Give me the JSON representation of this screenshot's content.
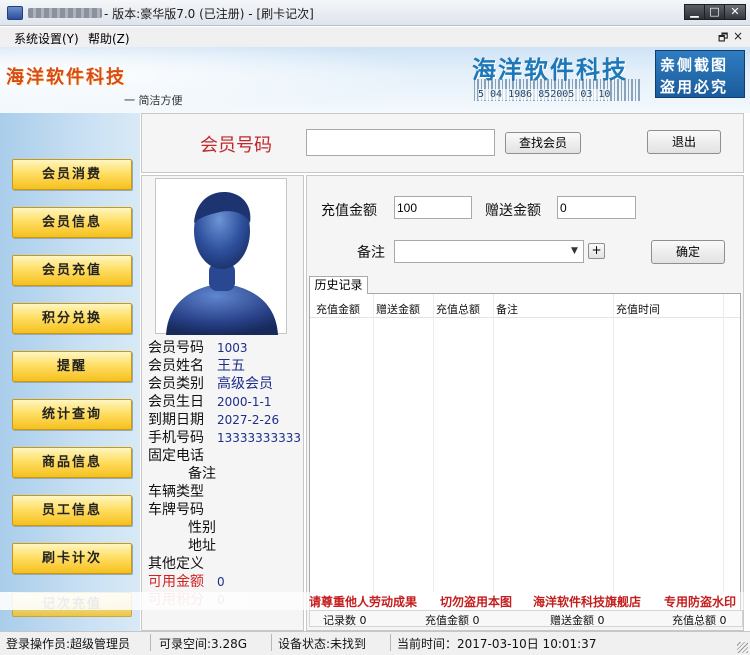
{
  "titlebar": {
    "title": "- 版本:豪华版7.0 (已注册) - [刷卡记次]",
    "min_label": "▁",
    "max_label": "□",
    "close_label": "✕"
  },
  "menu": {
    "settings": "系统设置(Y)",
    "help": "帮助(Z)",
    "restore": "🗗",
    "close": "×"
  },
  "banner": {
    "logo": "海洋软件科技",
    "slogan": "一 简洁方便",
    "title": "海洋软件科技",
    "barcode_text": "5 04 1986 852005 03 10",
    "stamp_line1": "亲侧截图",
    "stamp_line2": "盗用必究"
  },
  "nav": {
    "items": [
      "会员消费",
      "会员信息",
      "会员充值",
      "积分兑换",
      "提醒",
      "统计查询",
      "商品信息",
      "员工信息",
      "刷卡计次"
    ],
    "partial_item": "记次充值"
  },
  "search": {
    "label": "会员号码",
    "value": "",
    "find_button": "查找会员",
    "exit_button": "退出"
  },
  "member": {
    "rows": [
      {
        "label": "会员号码",
        "value": "1003"
      },
      {
        "label": "会员姓名",
        "value": "王五"
      },
      {
        "label": "会员类别",
        "value": "高级会员"
      },
      {
        "label": "会员生日",
        "value": "2000-1-1"
      },
      {
        "label": "到期日期",
        "value": "2027-2-26"
      },
      {
        "label": "手机号码",
        "value": "13333333333"
      },
      {
        "label": "固定电话",
        "value": ""
      },
      {
        "label": "备注",
        "value": ""
      },
      {
        "label": "车辆类型",
        "value": ""
      },
      {
        "label": "车牌号码",
        "value": ""
      },
      {
        "label": "性别",
        "value": ""
      },
      {
        "label": "地址",
        "value": ""
      },
      {
        "label": "其他定义",
        "value": ""
      },
      {
        "label": "可用金额",
        "value": "0"
      },
      {
        "label": "可用积分",
        "value": "0"
      }
    ]
  },
  "form": {
    "amount_label": "充值金额",
    "amount_value": "100",
    "gift_label": "赠送金额",
    "gift_value": "0",
    "note_label": "备注",
    "note_value": "",
    "plus_label": "+",
    "ok_button": "确定"
  },
  "history": {
    "tab_label": "历史记录",
    "columns": [
      "充值金额",
      "赠送金额",
      "充值总额",
      "备注",
      "充值时间"
    ],
    "rows": []
  },
  "watermark": {
    "items": [
      "请尊重他人劳动成果",
      "切勿盗用本图",
      "海洋软件科技旗舰店",
      "专用防盗水印"
    ]
  },
  "totals": {
    "count": "记录数 0",
    "amount": "充值金额 0",
    "gift": "赠送金额 0",
    "total": "充值总额 0"
  },
  "status": {
    "operator": "登录操作员:超级管理员",
    "space": "可录空间:3.28G",
    "device": "设备状态:未找到",
    "time": "当前时间：2017-03-10日 10:01:37"
  }
}
